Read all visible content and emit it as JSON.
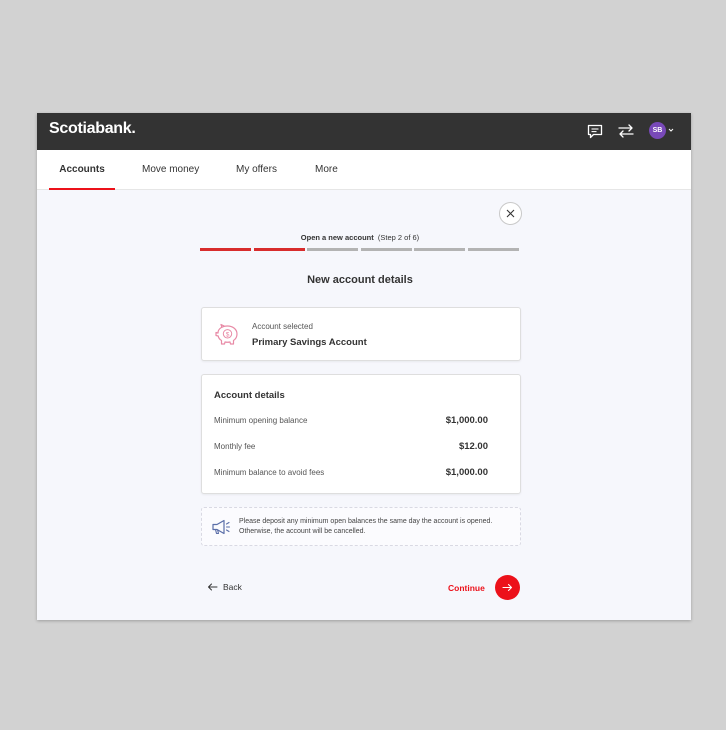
{
  "brand": {
    "name": "Scotiabank.",
    "accent": "#ec111a",
    "header_bg": "#333333"
  },
  "header": {
    "icons": [
      "chat-icon",
      "transfer-icon"
    ],
    "avatar_initials": "SB",
    "avatar_color": "#7849b8"
  },
  "nav": {
    "items": [
      {
        "label": "Accounts",
        "active": true
      },
      {
        "label": "Move money",
        "active": false
      },
      {
        "label": "My offers",
        "active": false
      },
      {
        "label": "More",
        "active": false
      }
    ]
  },
  "progress": {
    "label": "Open a new account",
    "step_text": "(Step 2 of 6)",
    "current_step": 2,
    "total_steps": 6,
    "complete_color": "#d82c2c",
    "incomplete_color": "#b3b3b3"
  },
  "page": {
    "title": "New account details"
  },
  "selected_account": {
    "label": "Account selected",
    "name": "Primary Savings Account",
    "icon": "piggy-bank-icon"
  },
  "details": {
    "title": "Account details",
    "rows": [
      {
        "label": "Minimum opening balance",
        "value": "$1,000.00"
      },
      {
        "label": "Monthly fee",
        "value": "$12.00"
      },
      {
        "label": "Minimum balance to avoid fees",
        "value": "$1,000.00"
      }
    ]
  },
  "notice": {
    "icon": "megaphone-icon",
    "line1": "Please deposit any minimum open balances the same day the account is opened.",
    "line2": "Otherwise, the account will be cancelled."
  },
  "actions": {
    "back_label": "Back",
    "continue_label": "Continue"
  }
}
